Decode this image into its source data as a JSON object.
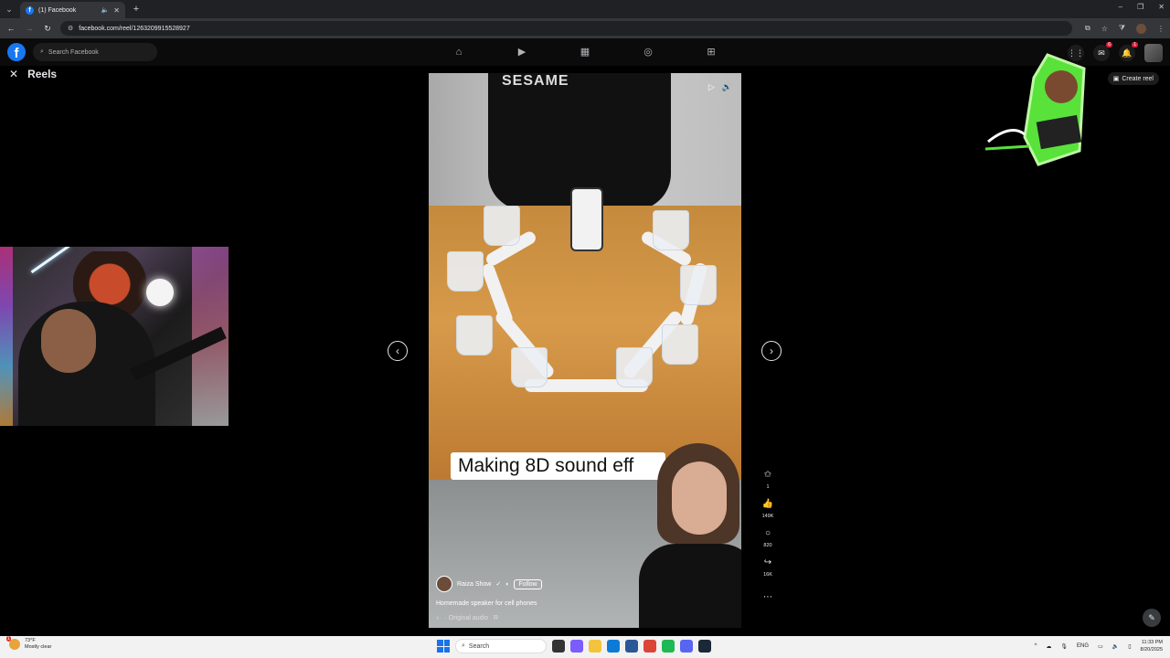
{
  "browser": {
    "tab_title": "(1) Facebook",
    "url": "facebook.com/reel/1263209915528927",
    "new_tab_symbol": "+"
  },
  "facebook": {
    "logo_letter": "f",
    "search_placeholder": "Search Facebook",
    "notifications_badge": "1",
    "messenger_badge": "6"
  },
  "reels": {
    "title": "Reels",
    "create_label": "Create reel"
  },
  "video": {
    "shirt_text": "SESAME",
    "caption": "Making 8D sound eff",
    "author": "Raiza Show",
    "follow_label": "Follow",
    "description": "Homemade speaker for cell phones",
    "audio": "· Original audio",
    "audio_suffix": "R"
  },
  "actions": {
    "remix_count": "1",
    "like_count": "149K",
    "comment_count": "820",
    "share_count": "16K"
  },
  "taskbar": {
    "weather_temp": "73°F",
    "weather_desc": "Mostly clear",
    "weather_badge": "1",
    "search_label": "Search",
    "lang": "ENG",
    "time": "11:33 PM",
    "date": "8/20/2025"
  },
  "colors": {
    "fb_blue": "#1877f2",
    "bg": "#000000",
    "taskbar": "#f2f2f2"
  },
  "icons": [
    "home-icon",
    "video-icon",
    "marketplace-icon",
    "groups-icon",
    "gaming-icon",
    "menu-grid-icon",
    "messenger-icon",
    "bell-icon",
    "close-icon",
    "chevron-left-icon",
    "chevron-right-icon",
    "remix-icon",
    "like-icon",
    "comment-icon",
    "share-icon",
    "more-icon",
    "edit-icon",
    "play-icon",
    "volume-icon"
  ]
}
